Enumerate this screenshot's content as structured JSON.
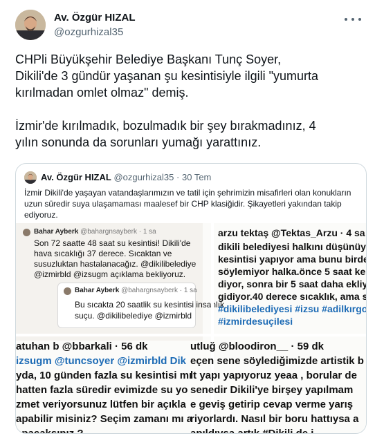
{
  "tweet": {
    "author_name": "Av. Özgür HIZAL",
    "author_handle": "@ozgurhizal35",
    "body": "CHPli Büyükşehir Belediye Başkanı Tunç Soyer,\nDikili'de 3 gündür yaşanan şu kesintisiyle ilgili \"yumurta\nkırılmadan omlet olmaz\" demiş.\n\nİzmir'de kırılmadık, bozulmadık bir şey bırakmadınız, 4\nyılın sonunda da sorunları yumağı yarattınız."
  },
  "quote": {
    "author_name": "Av. Özgür HIZAL",
    "author_handle": "@ozgurhizal35",
    "dot": "·",
    "date": "30 Tem",
    "text": "İzmir Dikili'de yaşayan vatandaşlarımızın ve tatil için şehrimizin misafirleri olan konukların uzun süredir suya ulaşamaması maalesef bir CHP klasiğidir. Şikayetleri yakından takip ediyoruz."
  },
  "media": {
    "p1": {
      "name": "Bahar Ayberk",
      "handle": "@bahargnsayberk · 1 sa",
      "lines": [
        "Son 72 saatte 48 saat su kesintisi! Dikili'de",
        "hava sıcaklığı 37 derece.  Sıcaktan ve",
        "susuzluktan hastalanacağız. @dikilibelediye",
        "@izmirbld @izsugm açıklama bekliyoruz."
      ]
    },
    "p2": {
      "name": "Bahar Ayberk",
      "handle": "@bahargnsayberk · 1 sa",
      "lines": [
        "Bu sıcakta 20 saatlik su kesintisi insanlık",
        "suçu. @dikilibelediye @izmirbld"
      ]
    },
    "p3": {
      "header": "arzu tektaş @Tektas_Arzu · 4 sa",
      "lines": [
        "dikili belediyesi halkını düşünüyor.24 s",
        "kesintisi yapıyor ama bunu birden bire",
        "söylemiyor halka.önce 5 saat kesinti va",
        "diyor, sonra bir 5 saat daha ekliyor.bu b",
        "gidiyor.40 derece sıcaklık, ama su yok.",
        "#dikilibelediyesi #izsu #adilkırgoz",
        "#izmirdesuçilesi"
      ]
    },
    "p4": {
      "header": "atuhan b @bbarkali · 56 dk",
      "lines": [
        "izsugm @tuncsoyer @izmirbld Dik",
        "yda, 10 günden fazla su kesintisi mı",
        "hatten fazla süredir evimizde su yo",
        "zmet veriyorsunuz lütfen bir açıkla",
        "apabilir misiniz? Seçim zamanı mı a",
        "apacaksınız ?"
      ]
    },
    "p5": {
      "header": "utluğ @bloodiron__ · 59 dk",
      "lines": [
        "eçen sene söylediğimizde artistik b",
        "lt yapı yapıyoruz yeaa , borular de",
        "senedir Dikili'ye birşey yapılmam",
        "e geviş getirip cevap verme yarış",
        "riyorlardı.  Nasıl bir boru hattıysa a",
        "apıldıysa artık #Dikili de i"
      ]
    }
  }
}
